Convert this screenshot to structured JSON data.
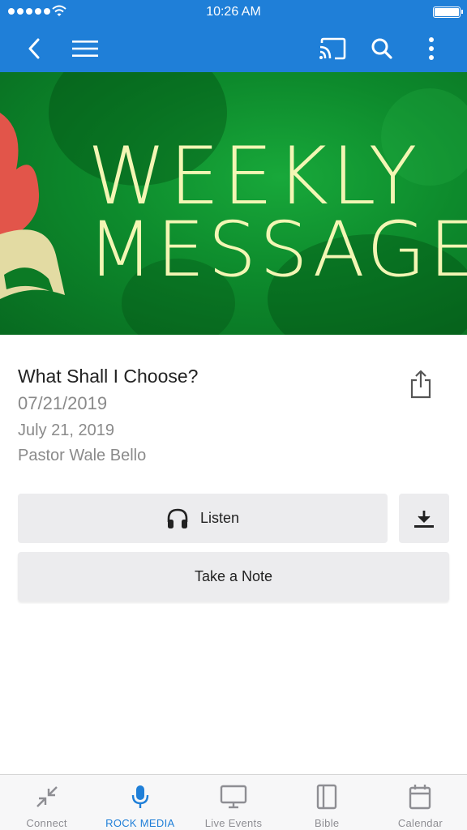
{
  "status_bar": {
    "time": "10:26 AM"
  },
  "app_bar": {
    "back_icon": "chevron-left-icon",
    "menu_icon": "hamburger-menu-icon",
    "cast_icon": "cast-icon",
    "search_icon": "search-icon",
    "more_icon": "more-vertical-icon"
  },
  "hero": {
    "line1": "WEEKLY",
    "line2": "MESSAGES"
  },
  "sermon": {
    "title": "What Shall I Choose?",
    "date_code": "07/21/2019",
    "date_long": "July 21, 2019",
    "speaker": "Pastor Wale Bello"
  },
  "actions": {
    "listen_label": "Listen",
    "note_label": "Take a Note"
  },
  "tabs": [
    {
      "label": "Connect",
      "icon": "compress-arrows-icon"
    },
    {
      "label": "ROCK MEDIA",
      "icon": "microphone-icon"
    },
    {
      "label": "Live Events",
      "icon": "monitor-icon"
    },
    {
      "label": "Bible",
      "icon": "book-icon"
    },
    {
      "label": "Calendar",
      "icon": "calendar-icon"
    }
  ],
  "colors": {
    "accent": "#1f7fd8",
    "hero_green": "#0d8a2c",
    "hero_text": "#f3f6b4",
    "button_bg": "#ececee"
  }
}
